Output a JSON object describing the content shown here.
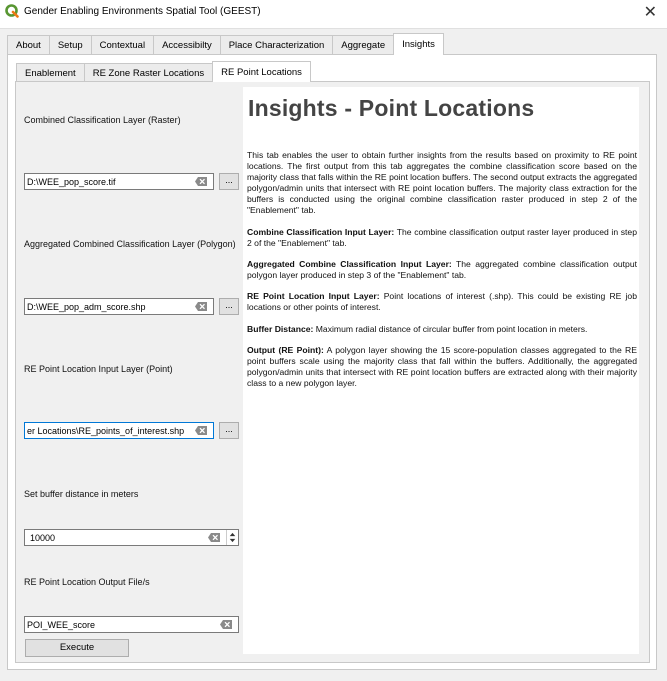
{
  "window": {
    "title": "Gender Enabling Environments Spatial Tool (GEEST)",
    "close_glyph": "✕"
  },
  "main_tabs": [
    {
      "label": "About"
    },
    {
      "label": "Setup"
    },
    {
      "label": "Contextual"
    },
    {
      "label": "Accessibilty"
    },
    {
      "label": "Place Characterization"
    },
    {
      "label": "Aggregate"
    },
    {
      "label": "Insights",
      "active": true
    }
  ],
  "sub_tabs": [
    {
      "label": "Enablement"
    },
    {
      "label": "RE Zone Raster Locations"
    },
    {
      "label": "RE Point Locations",
      "active": true
    }
  ],
  "form": {
    "combined_label": "Combined Classification Layer (Raster)",
    "combined_value": "D:\\WEE_pop_score.tif",
    "aggregated_label": "Aggregated Combined Classification Layer (Polygon)",
    "aggregated_value": "D:\\WEE_pop_adm_score.shp",
    "point_label": "RE Point Location Input Layer (Point)",
    "point_value": "er Locations\\RE_points_of_interest.shp",
    "buffer_label": "Set buffer distance in meters",
    "buffer_value": "10000",
    "output_label": "RE Point Location Output File/s",
    "output_value": "POI_WEE_score",
    "browse_label": "...",
    "execute_label": "Execute"
  },
  "help": {
    "heading": "Insights - Point Locations",
    "intro": "This tab enables the user to obtain further insights from the results based on proximity to RE point locations. The first output from this tab aggregates the combine classification score based on the majority class that falls within the RE point location buffers. The second output extracts the aggregated polygon/admin units that intersect with RE point location buffers. The majority class extraction for the buffers is conducted using the original combine classification raster produced in step 2 of the \"Enablement\" tab.",
    "combine_term": "Combine Classification Input Layer:",
    "combine_desc": " The combine classification output raster layer produced in step 2 of the  \"Enablement\" tab.",
    "aggregated_term": "Aggregated Combine Classification Input Layer:",
    "aggregated_desc": " The aggregated combine classification output polygon layer produced in step 3 of the  \"Enablement\" tab.",
    "point_term": "RE Point Location Input Layer:",
    "point_desc": " Point locations of interest (.shp). This could be existing RE job locations or other points of interest.",
    "buffer_term": "Buffer Distance:",
    "buffer_desc": " Maximum radial distance of circular buffer from point location in meters.",
    "output_term": "Output (RE Point):",
    "output_desc": " A polygon layer showing the 15 score-population classes aggregated to the RE point buffers scale using the majority class that fall within the buffers. Additionally, the aggregated polygon/admin units that intersect with RE point location buffers are extracted along with their majority class to a new polygon layer."
  },
  "icons": {
    "app": "qgis-logo-icon",
    "clear": "clear-field-icon",
    "spin": "spin-arrows-icon"
  },
  "colors": {
    "focus_border": "#0078d7",
    "qgis_green": "#589632",
    "qgis_yellow": "#ee7913"
  }
}
